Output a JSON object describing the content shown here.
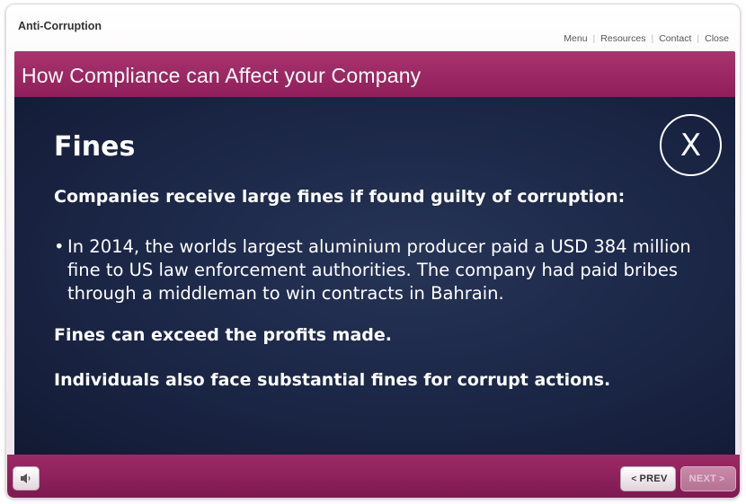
{
  "app": {
    "title": "Anti-Corruption"
  },
  "top_nav": {
    "items": [
      "Menu",
      "Resources",
      "Contact",
      "Close"
    ],
    "separator": "|"
  },
  "slide": {
    "title": "How Compliance can Affect your Company",
    "heading": "Fines",
    "close_label": "X",
    "lead": "Companies receive large fines if found guilty of corruption:",
    "bullet_marker": "•",
    "bullet": "In 2014, the worlds largest aluminium producer paid a USD 384 million fine to US law enforcement authorities. The company had paid bribes through a middleman to win contracts in Bahrain.",
    "point_1": "Fines can exceed the profits made.",
    "point_2": "Individuals also face substantial fines for corrupt actions."
  },
  "footer": {
    "audio_icon": "speaker-icon",
    "prev_label": "PREV",
    "prev_chevron": "<",
    "next_label": "NEXT",
    "next_chevron": ">",
    "next_enabled": false
  },
  "colors": {
    "brand_magenta": "#9c2a66",
    "content_navy": "#1b2646"
  }
}
